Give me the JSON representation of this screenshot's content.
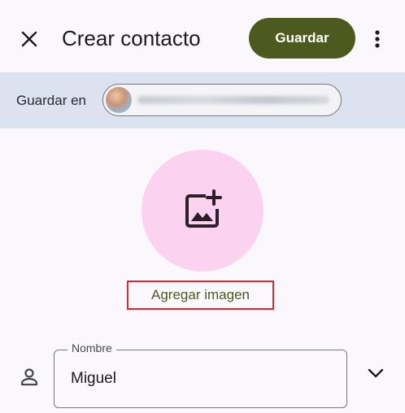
{
  "header": {
    "title": "Crear contacto",
    "save_label": "Guardar",
    "close_icon": "close-icon",
    "more_icon": "more-vert-icon"
  },
  "save_in": {
    "label": "Guardar en"
  },
  "photo": {
    "icon": "add-photo-icon",
    "add_label": "Agregar imagen"
  },
  "name_field": {
    "label": "Nombre",
    "value": "Miguel",
    "icon": "person-icon",
    "expand_icon": "chevron-down-icon"
  },
  "colors": {
    "background": "#fbf8fd",
    "primary_button": "#4c5a1f",
    "save_in_band": "#dde2f1",
    "photo_circle": "#fbd3f1",
    "link_text": "#4c5a1f",
    "highlight_box": "#e8262a"
  }
}
